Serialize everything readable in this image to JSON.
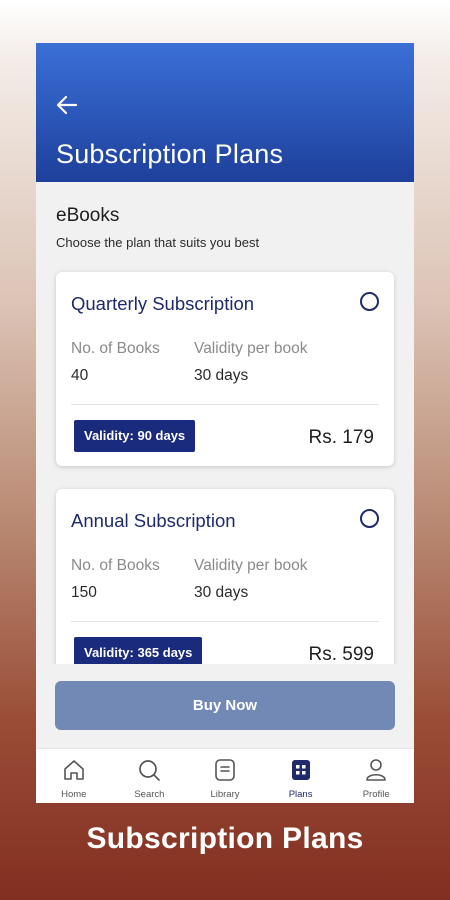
{
  "header": {
    "title": "Subscription Plans"
  },
  "section": {
    "title": "eBooks",
    "subtitle": "Choose the plan that suits you best"
  },
  "plans": [
    {
      "name": "Quarterly Subscription",
      "books_label": "No. of Books",
      "books_value": "40",
      "validity_per_book_label": "Validity per book",
      "validity_per_book_value": "30 days",
      "validity_badge": "Validity: 90 days",
      "price": "Rs. 179",
      "selected": false
    },
    {
      "name": "Annual Subscription",
      "books_label": "No. of Books",
      "books_value": "150",
      "validity_per_book_label": "Validity per book",
      "validity_per_book_value": "30 days",
      "validity_badge": "Validity: 365 days",
      "price": "Rs. 599",
      "selected": false
    }
  ],
  "buy_button": {
    "label": "Buy Now"
  },
  "nav": {
    "items": [
      {
        "label": "Home",
        "icon": "home-icon",
        "active": false
      },
      {
        "label": "Search",
        "icon": "search-icon",
        "active": false
      },
      {
        "label": "Library",
        "icon": "library-icon",
        "active": false
      },
      {
        "label": "Plans",
        "icon": "plans-icon",
        "active": true
      },
      {
        "label": "Profile",
        "icon": "profile-icon",
        "active": false
      }
    ]
  },
  "caption": "Subscription Plans",
  "colors": {
    "header_blue": "#2a56b8",
    "brand_navy": "#1a2a7c",
    "buy_button": "#7389b5"
  }
}
